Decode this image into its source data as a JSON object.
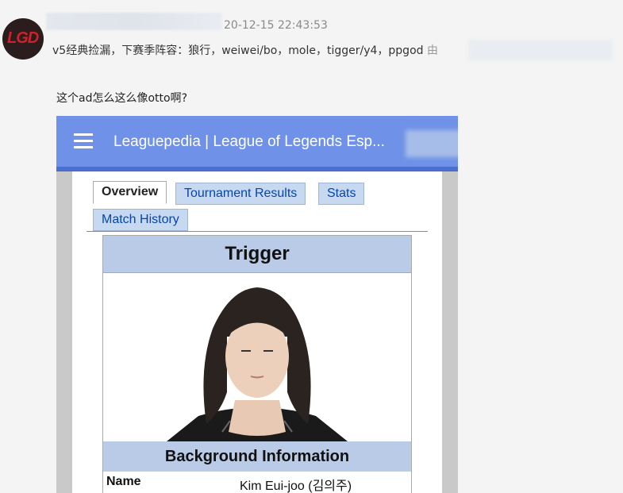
{
  "post": {
    "timestamp": "20-12-15 22:43:53",
    "title": "v5经典捡漏，下赛季阵容：狼行，weiwei/bo，mole，tigger/y4，ppgod",
    "title_suffix": "由",
    "avatar_text": "LGD"
  },
  "reply": {
    "text": "这个ad怎么这么像otto啊?"
  },
  "screenshot": {
    "site_title": "Leaguepedia | League of Legends Esp...",
    "tabs": [
      {
        "label": "Overview",
        "active": true
      },
      {
        "label": "Tournament Results",
        "active": false
      },
      {
        "label": "Stats",
        "active": false
      },
      {
        "label": "Match History",
        "active": false
      }
    ],
    "infobox": {
      "title": "Trigger",
      "section": "Background Information",
      "rows": [
        {
          "label": "Name",
          "value": "Kim Eui-joo (김의주)"
        }
      ]
    }
  },
  "colors": {
    "appbar": "#6f92e8",
    "infobox_header": "#b9cbe6",
    "link": "#0645ad",
    "avatar_logo": "#d0202a"
  },
  "icons": [
    "hamburger-menu-icon"
  ]
}
